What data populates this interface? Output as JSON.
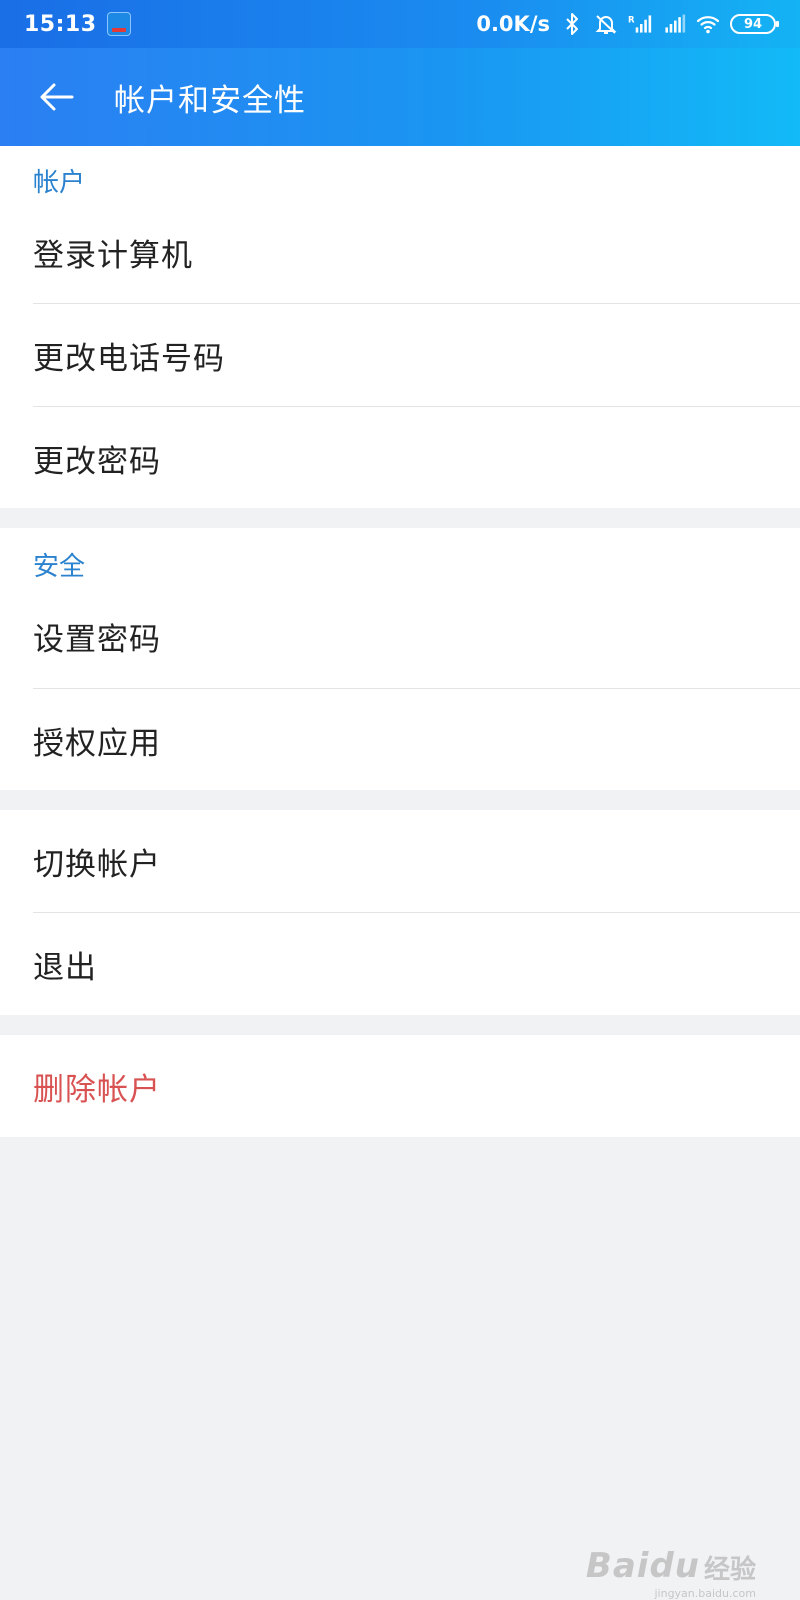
{
  "status_bar": {
    "time": "15:13",
    "net_speed": "0.0K/s",
    "battery": "94",
    "icons": [
      "app-badge-icon",
      "bluetooth-icon",
      "bell-off-icon",
      "signal-r-icon",
      "signal-icon",
      "wifi-icon",
      "battery-icon"
    ]
  },
  "appbar": {
    "title": "帐户和安全性",
    "back_icon": "arrow-left-icon"
  },
  "sections": {
    "account": {
      "header": "帐户",
      "items": [
        "登录计算机",
        "更改电话号码",
        "更改密码"
      ]
    },
    "security": {
      "header": "安全",
      "items": [
        "设置密码",
        "授权应用"
      ]
    },
    "session": {
      "items": [
        "切换帐户",
        "退出"
      ]
    },
    "danger": {
      "items": [
        "删除帐户"
      ]
    }
  },
  "watermark": {
    "main": "Bai",
    "paw": "du",
    "cn": "经验",
    "url": "jingyan.baidu.com"
  },
  "colors": {
    "section_header": "#2b82cf",
    "danger": "#d95252",
    "background": "#f1f2f4",
    "appbar_start": "#2b7ff2",
    "appbar_end": "#12baf7"
  }
}
